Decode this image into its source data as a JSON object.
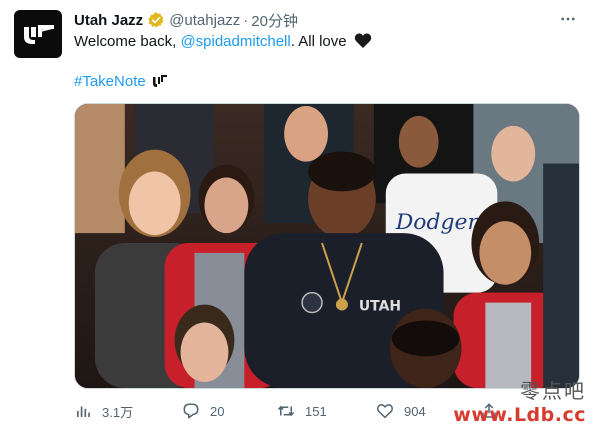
{
  "tweet": {
    "author": {
      "display_name": "Utah Jazz",
      "handle": "@utahjazz",
      "verified": true,
      "avatar_icon": "utah-jazz-logo-icon"
    },
    "separator": "·",
    "time": "20分钟",
    "text_before": "Welcome back, ",
    "mention": "@spidadmitchell",
    "text_after": ". All love",
    "heart_emoji": "black-heart-icon",
    "hashtag": "#TakeNote",
    "hashflag_icon": "jazz-note-hashflag-icon",
    "media": {
      "description_icon": "photo-crowd-image"
    },
    "actions": {
      "views": "3.1万",
      "replies": "20",
      "retweets": "151",
      "likes": "904"
    },
    "more_icon": "more-options-icon"
  },
  "watermark": {
    "chinese": "零点吧",
    "url": "www.Ldb.cc"
  },
  "colors": {
    "link": "#1d9bf0",
    "secondary": "#536471",
    "verified_gold": "#e2b719"
  }
}
